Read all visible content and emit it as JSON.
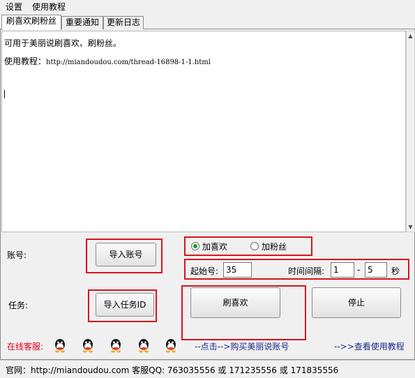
{
  "menu": {
    "settings": "设置",
    "tutorial": "使用教程"
  },
  "tabs": [
    {
      "label": "刷喜欢刷粉丝",
      "active": true
    },
    {
      "label": "重要通知",
      "active": false
    },
    {
      "label": "更新日志",
      "active": false
    }
  ],
  "log": {
    "line1": "可用于美丽说刷喜欢、刷粉丝。",
    "line2_prefix": "使用教程：",
    "line2_url": "http://miandoudou.com/thread-16898-1-1.html"
  },
  "account": {
    "label": "账号:",
    "import_button": "导入账号"
  },
  "task": {
    "label": "任务:",
    "import_button": "导入任务ID"
  },
  "mode": {
    "option_like": "加喜欢",
    "option_fans": "加粉丝",
    "selected": "加喜欢"
  },
  "params": {
    "start_label": "起始号:",
    "start_value": "35",
    "interval_label": "时间间隔:",
    "interval_min": "1",
    "interval_sep": "-",
    "interval_max": "5",
    "interval_unit": "秒"
  },
  "actions": {
    "start_button": "刷喜欢",
    "stop_button": "停止"
  },
  "support": {
    "label": "在线客服:",
    "qq_count": 5,
    "buy_link": "--点击-->购买美丽说账号",
    "tutorial_link": "-->>查看使用教程"
  },
  "status": {
    "text": "官网：http://miandoudou.com 客服QQ: 763035556 或 171235556 或 171835556"
  },
  "colors": {
    "highlight_box": "#d7141e",
    "support_label": "#e0001a",
    "link": "#1a2a8a",
    "radio_dot": "#1c9a2a"
  }
}
